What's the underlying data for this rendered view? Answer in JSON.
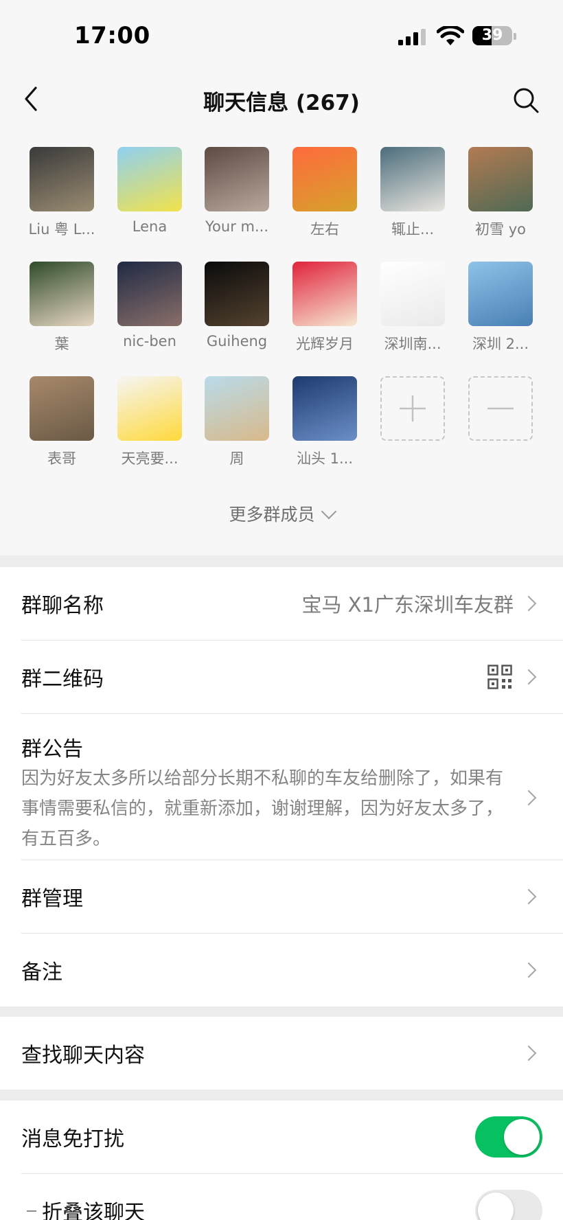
{
  "status_bar": {
    "time": "17:00",
    "battery": "39"
  },
  "nav": {
    "title": "聊天信息 (267)"
  },
  "members": [
    {
      "name": "Liu 粤 L...",
      "colors": [
        "#3a3a3a",
        "#9a8c72"
      ]
    },
    {
      "name": "Lena",
      "colors": [
        "#8fd0f2",
        "#f2e24a"
      ]
    },
    {
      "name": "Your m...",
      "colors": [
        "#5d4b44",
        "#b8a89c"
      ]
    },
    {
      "name": "左右",
      "colors": [
        "#ff6a3d",
        "#d6a22b"
      ]
    },
    {
      "name": "辄止...",
      "colors": [
        "#4b6d7c",
        "#e9e5df"
      ]
    },
    {
      "name": "初雪 yo",
      "colors": [
        "#b37a52",
        "#4f6a54"
      ]
    },
    {
      "name": "葉",
      "colors": [
        "#2f4b2a",
        "#e7d7c2"
      ]
    },
    {
      "name": "nic-ben",
      "colors": [
        "#1f2a44",
        "#8a6f6a"
      ]
    },
    {
      "name": "Guiheng",
      "colors": [
        "#0b0b0b",
        "#54422f"
      ]
    },
    {
      "name": "光辉岁月",
      "colors": [
        "#e0233c",
        "#f7e7d2"
      ]
    },
    {
      "name": "深圳南...",
      "colors": [
        "#ffffff",
        "#eaeaea"
      ]
    },
    {
      "name": "深圳 2...",
      "colors": [
        "#8ec3e8",
        "#4a7fb5"
      ]
    },
    {
      "name": "表哥",
      "colors": [
        "#a7896a",
        "#6a5946"
      ]
    },
    {
      "name": "天亮要...",
      "colors": [
        "#f5f5f5",
        "#ffd93b"
      ]
    },
    {
      "name": "周",
      "colors": [
        "#b9dbea",
        "#d8b98a"
      ]
    },
    {
      "name": "汕头 1...",
      "colors": [
        "#1e3a6e",
        "#6c8fc9"
      ]
    }
  ],
  "more_members_label": "更多群成员",
  "settings": {
    "group_name_label": "群聊名称",
    "group_name_value": "宝马 X1广东深圳车友群",
    "qr_label": "群二维码",
    "announcement_label": "群公告",
    "announcement_text": "因为好友太多所以给部分长期不私聊的车友给删除了，如果有事情需要私信的，就重新添加，谢谢理解，因为好友太多了，有五百多。",
    "manage_label": "群管理",
    "remark_label": "备注",
    "search_label": "查找聊天内容",
    "mute_label": "消息免打扰",
    "mute_on": true,
    "fold_label": "折叠该聊天",
    "fold_on": false
  },
  "accent_color": "#07c160"
}
